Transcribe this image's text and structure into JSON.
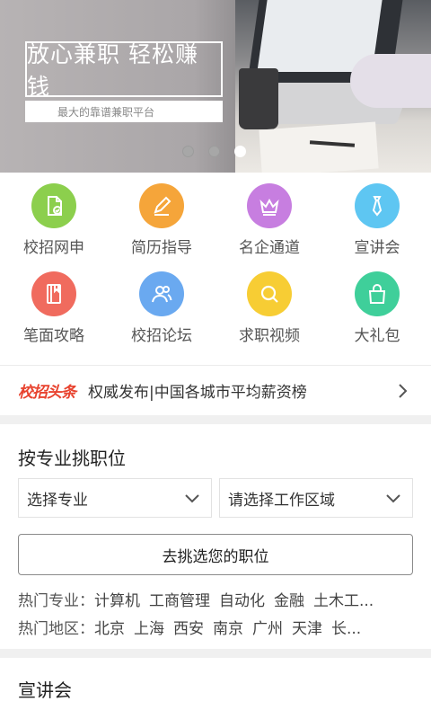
{
  "banner": {
    "slogan": "放心兼职  轻松赚钱",
    "subtitle": "最大的靠谱兼职平台",
    "dots": [
      false,
      false,
      true
    ]
  },
  "grid": [
    {
      "label": "校招网申",
      "icon": "document-check-icon",
      "color": "#8ccf4d"
    },
    {
      "label": "简历指导",
      "icon": "pencil-icon",
      "color": "#f5a53a"
    },
    {
      "label": "名企通道",
      "icon": "crown-icon",
      "color": "#c77ee0"
    },
    {
      "label": "宣讲会",
      "icon": "tie-icon",
      "color": "#5ec6f2"
    },
    {
      "label": "笔面攻略",
      "icon": "notebook-icon",
      "color": "#f06b5e"
    },
    {
      "label": "校招论坛",
      "icon": "users-icon",
      "color": "#6aa9f0"
    },
    {
      "label": "求职视频",
      "icon": "search-icon",
      "color": "#f7cd34"
    },
    {
      "label": "大礼包",
      "icon": "gift-bag-icon",
      "color": "#3fcf9a"
    }
  ],
  "headline": {
    "tag": "校招头条",
    "text": "权威发布|中国各城市平均薪资榜"
  },
  "major_section": {
    "title": "按专业挑职位",
    "major_select": "选择专业",
    "area_select": "请选择工作区域",
    "cta": "去挑选您的职位",
    "hot_major_label": "热门专业：",
    "hot_majors": [
      "计算机",
      "工商管理",
      "自动化",
      "金融",
      "土木工..."
    ],
    "hot_area_label": "热门地区：",
    "hot_areas": [
      "北京",
      "上海",
      "西安",
      "南京",
      "广州",
      "天津",
      "长..."
    ]
  },
  "next_section": {
    "title": "宣讲会"
  }
}
